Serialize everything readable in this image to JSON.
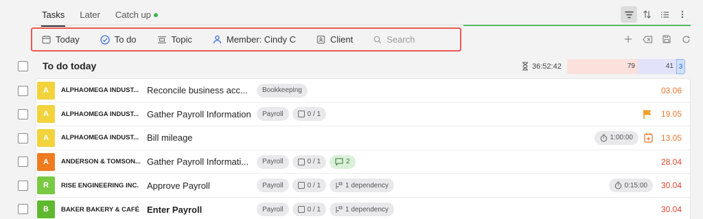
{
  "tabs": [
    {
      "label": "Tasks",
      "active": true
    },
    {
      "label": "Later",
      "active": false
    },
    {
      "label": "Catch up",
      "active": false,
      "status_dot": true
    }
  ],
  "filters": {
    "today": "Today",
    "todo": "To do",
    "topic": "Topic",
    "member": "Member: Cindy C",
    "client": "Client",
    "search_placeholder": "Search"
  },
  "section": {
    "title": "To do today",
    "total_time": "36:52:42",
    "count_red": "79",
    "count_blue": "41",
    "count_extra": "3"
  },
  "rows": [
    {
      "avatar": "A",
      "avatar_color": "#f2d33b",
      "client": "ALPHAOMEGA INDUST...",
      "task": "Reconcile business acc...",
      "tags": [
        "Bookkeeping"
      ],
      "date": "03.06",
      "date_color": "#e8772e"
    },
    {
      "avatar": "A",
      "avatar_color": "#f2d33b",
      "client": "ALPHAOMEGA INDUST...",
      "task": "Gather Payroll Information",
      "tags": [
        "Payroll"
      ],
      "checklist": "0 / 1",
      "flag": true,
      "date": "19.05",
      "date_color": "#e8772e"
    },
    {
      "avatar": "A",
      "avatar_color": "#f2d33b",
      "client": "ALPHAOMEGA INDUST...",
      "task": "Bill mileage",
      "timer": "1:00:00",
      "date": "13.05",
      "date_color": "#e8772e",
      "calendar_icon": true
    },
    {
      "avatar": "A",
      "avatar_color": "#ef7b1f",
      "client": "ANDERSON & TOMSON...",
      "task": "Gather Payroll Informati...",
      "tags": [
        "Payroll"
      ],
      "checklist": "0 / 1",
      "comments": "2",
      "date": "28.04",
      "date_color": "#e0452b"
    },
    {
      "avatar": "R",
      "avatar_color": "#7ac943",
      "client": "RISE ENGINEERING INC.",
      "task": "Approve Payroll",
      "tags": [
        "Payroll"
      ],
      "checklist": "0 / 1",
      "dependency": "1 dependency",
      "timer": "0:15:00",
      "date": "30.04",
      "date_color": "#e0452b"
    },
    {
      "avatar": "B",
      "avatar_color": "#5fb82e",
      "client": "BAKER BAKERY & CAFÉ",
      "task": "Enter Payroll",
      "task_bold": true,
      "tags": [
        "Payroll"
      ],
      "checklist": "0 / 1",
      "dependency": "1 dependency",
      "date": "30.04",
      "date_color": "#e0452b"
    }
  ]
}
